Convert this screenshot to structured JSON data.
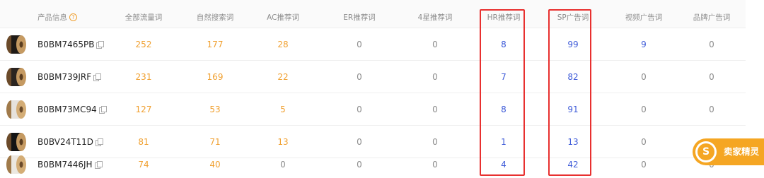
{
  "header": {
    "product_info": "产品信息",
    "help_icon_glyph": "?",
    "columns": [
      "全部流量词",
      "自然搜索词",
      "AC推荐词",
      "ER推荐词",
      "4星推荐词",
      "HR推荐词",
      "SP广告词",
      "视频广告词",
      "品牌广告词"
    ]
  },
  "rows": [
    {
      "asin": "B0BM7465PB",
      "values": [
        "252",
        "177",
        "28",
        "0",
        "0",
        "8",
        "99",
        "9",
        "0"
      ]
    },
    {
      "asin": "B0BM739JRF",
      "values": [
        "231",
        "169",
        "22",
        "0",
        "0",
        "7",
        "82",
        "0",
        "0"
      ]
    },
    {
      "asin": "B0BM73MC94",
      "values": [
        "127",
        "53",
        "5",
        "0",
        "0",
        "8",
        "91",
        "0",
        "0"
      ]
    },
    {
      "asin": "B0BV24T11D",
      "values": [
        "81",
        "71",
        "13",
        "0",
        "0",
        "1",
        "13",
        "0",
        "0"
      ]
    },
    {
      "asin": "B0BM7446JH",
      "values": [
        "74",
        "40",
        "0",
        "0",
        "0",
        "4",
        "42",
        "0",
        "0"
      ]
    }
  ],
  "brand": {
    "logo_glyph": "S",
    "name": "卖家精灵"
  },
  "colors": {
    "orange": "#f0a030",
    "blue": "#3d5ad8",
    "gray": "#8c8c8c",
    "highlight": "#e8302f",
    "brand": "#f5a623"
  }
}
